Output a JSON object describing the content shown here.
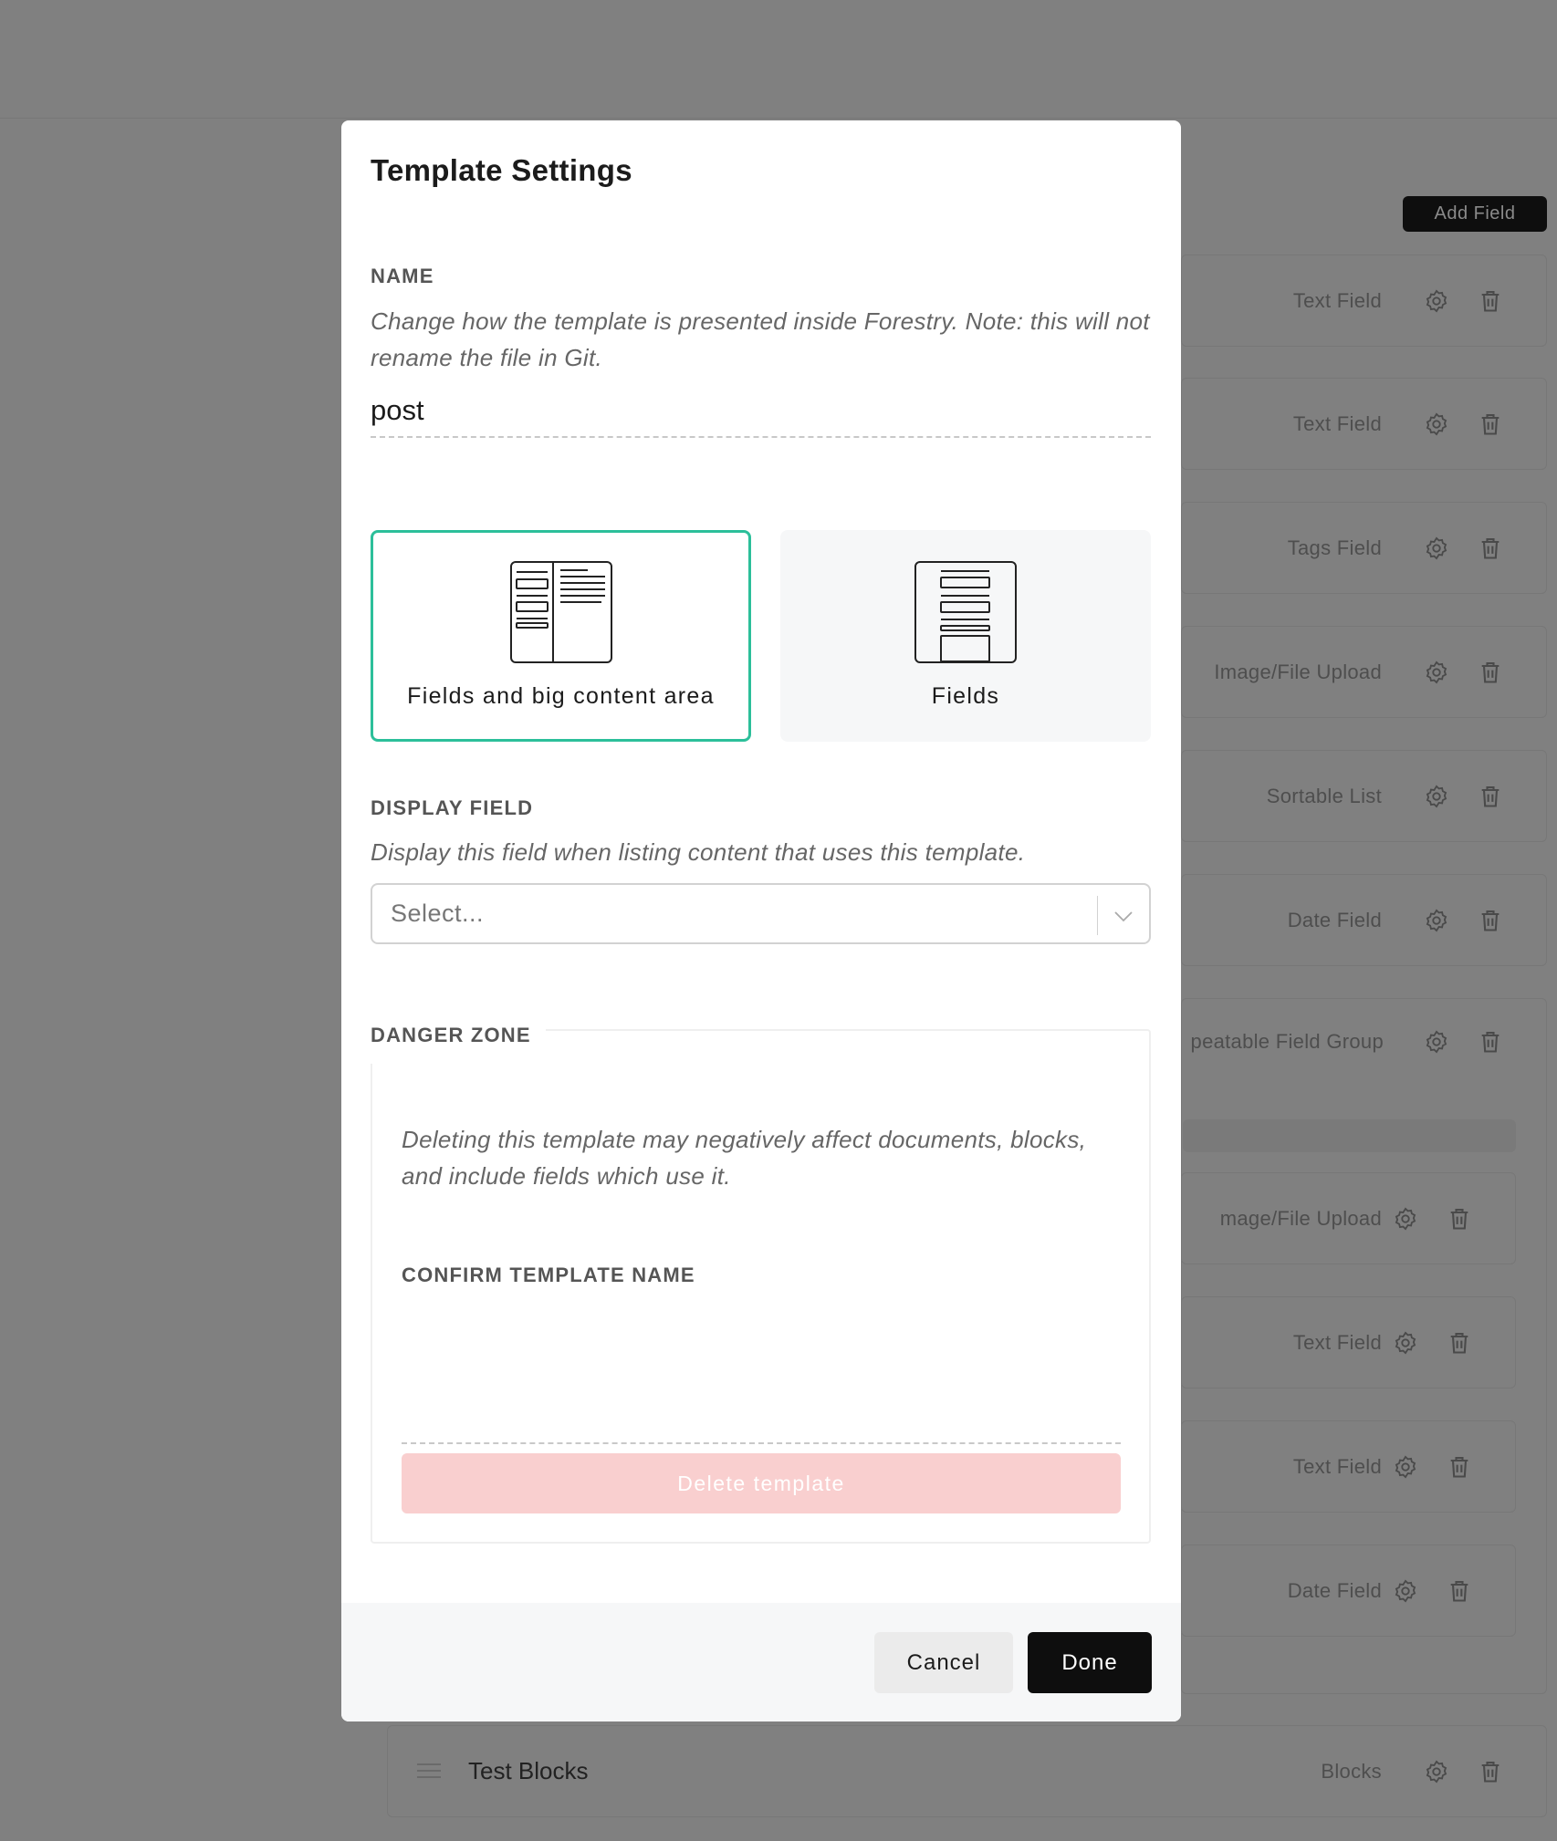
{
  "background": {
    "add_field_label": "Add Field",
    "field_rows": [
      {
        "type": "Text Field"
      },
      {
        "type": "Text Field"
      },
      {
        "type": "Tags Field"
      },
      {
        "type": "Image/File Upload"
      },
      {
        "type": "Sortable List"
      },
      {
        "type": "Date Field"
      },
      {
        "type": "peatable Field Group"
      }
    ],
    "nested_rows": [
      {
        "type": "mage/File Upload"
      },
      {
        "type": "Text Field"
      },
      {
        "type": "Text Field"
      },
      {
        "type": "Date Field"
      }
    ],
    "blocks_row": {
      "title": "Test Blocks",
      "type": "Blocks"
    }
  },
  "modal": {
    "title": "Template Settings",
    "name": {
      "label": "NAME",
      "help": "Change how the template is presented inside Forestry. Note: this will not rename the file in Git.",
      "value": "post"
    },
    "layouts": [
      {
        "label": "Fields and big content area",
        "selected": true,
        "icon": "fields-and-content-layout-icon"
      },
      {
        "label": "Fields",
        "selected": false,
        "icon": "fields-only-layout-icon"
      }
    ],
    "display_field": {
      "label": "DISPLAY FIELD",
      "help": "Display this field when listing content that uses this template.",
      "placeholder": "Select..."
    },
    "danger_zone": {
      "label": "DANGER ZONE",
      "help": "Deleting this template may negatively affect documents, blocks, and include fields which use it.",
      "confirm_label": "CONFIRM TEMPLATE NAME",
      "confirm_value": "",
      "delete_label": "Delete template"
    },
    "footer": {
      "cancel_label": "Cancel",
      "done_label": "Done"
    }
  },
  "colors": {
    "overlay": "#808080",
    "selected_border": "#2cbf9a",
    "delete_disabled_bg": "#f9cfcf",
    "done_bg": "#0e0e0e"
  }
}
